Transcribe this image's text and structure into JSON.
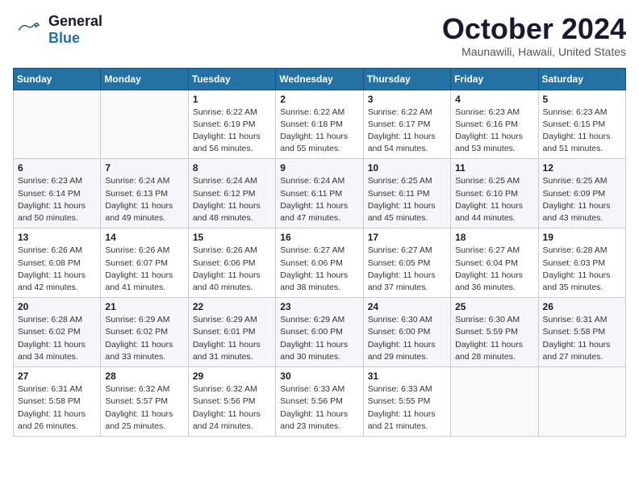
{
  "header": {
    "logo_line1": "General",
    "logo_line2": "Blue",
    "title": "October 2024",
    "subtitle": "Maunawili, Hawaii, United States"
  },
  "weekdays": [
    "Sunday",
    "Monday",
    "Tuesday",
    "Wednesday",
    "Thursday",
    "Friday",
    "Saturday"
  ],
  "weeks": [
    [
      {
        "day": "",
        "info": ""
      },
      {
        "day": "",
        "info": ""
      },
      {
        "day": "1",
        "info": "Sunrise: 6:22 AM\nSunset: 6:19 PM\nDaylight: 11 hours\nand 56 minutes."
      },
      {
        "day": "2",
        "info": "Sunrise: 6:22 AM\nSunset: 6:18 PM\nDaylight: 11 hours\nand 55 minutes."
      },
      {
        "day": "3",
        "info": "Sunrise: 6:22 AM\nSunset: 6:17 PM\nDaylight: 11 hours\nand 54 minutes."
      },
      {
        "day": "4",
        "info": "Sunrise: 6:23 AM\nSunset: 6:16 PM\nDaylight: 11 hours\nand 53 minutes."
      },
      {
        "day": "5",
        "info": "Sunrise: 6:23 AM\nSunset: 6:15 PM\nDaylight: 11 hours\nand 51 minutes."
      }
    ],
    [
      {
        "day": "6",
        "info": "Sunrise: 6:23 AM\nSunset: 6:14 PM\nDaylight: 11 hours\nand 50 minutes."
      },
      {
        "day": "7",
        "info": "Sunrise: 6:24 AM\nSunset: 6:13 PM\nDaylight: 11 hours\nand 49 minutes."
      },
      {
        "day": "8",
        "info": "Sunrise: 6:24 AM\nSunset: 6:12 PM\nDaylight: 11 hours\nand 48 minutes."
      },
      {
        "day": "9",
        "info": "Sunrise: 6:24 AM\nSunset: 6:11 PM\nDaylight: 11 hours\nand 47 minutes."
      },
      {
        "day": "10",
        "info": "Sunrise: 6:25 AM\nSunset: 6:11 PM\nDaylight: 11 hours\nand 45 minutes."
      },
      {
        "day": "11",
        "info": "Sunrise: 6:25 AM\nSunset: 6:10 PM\nDaylight: 11 hours\nand 44 minutes."
      },
      {
        "day": "12",
        "info": "Sunrise: 6:25 AM\nSunset: 6:09 PM\nDaylight: 11 hours\nand 43 minutes."
      }
    ],
    [
      {
        "day": "13",
        "info": "Sunrise: 6:26 AM\nSunset: 6:08 PM\nDaylight: 11 hours\nand 42 minutes."
      },
      {
        "day": "14",
        "info": "Sunrise: 6:26 AM\nSunset: 6:07 PM\nDaylight: 11 hours\nand 41 minutes."
      },
      {
        "day": "15",
        "info": "Sunrise: 6:26 AM\nSunset: 6:06 PM\nDaylight: 11 hours\nand 40 minutes."
      },
      {
        "day": "16",
        "info": "Sunrise: 6:27 AM\nSunset: 6:06 PM\nDaylight: 11 hours\nand 38 minutes."
      },
      {
        "day": "17",
        "info": "Sunrise: 6:27 AM\nSunset: 6:05 PM\nDaylight: 11 hours\nand 37 minutes."
      },
      {
        "day": "18",
        "info": "Sunrise: 6:27 AM\nSunset: 6:04 PM\nDaylight: 11 hours\nand 36 minutes."
      },
      {
        "day": "19",
        "info": "Sunrise: 6:28 AM\nSunset: 6:03 PM\nDaylight: 11 hours\nand 35 minutes."
      }
    ],
    [
      {
        "day": "20",
        "info": "Sunrise: 6:28 AM\nSunset: 6:02 PM\nDaylight: 11 hours\nand 34 minutes."
      },
      {
        "day": "21",
        "info": "Sunrise: 6:29 AM\nSunset: 6:02 PM\nDaylight: 11 hours\nand 33 minutes."
      },
      {
        "day": "22",
        "info": "Sunrise: 6:29 AM\nSunset: 6:01 PM\nDaylight: 11 hours\nand 31 minutes."
      },
      {
        "day": "23",
        "info": "Sunrise: 6:29 AM\nSunset: 6:00 PM\nDaylight: 11 hours\nand 30 minutes."
      },
      {
        "day": "24",
        "info": "Sunrise: 6:30 AM\nSunset: 6:00 PM\nDaylight: 11 hours\nand 29 minutes."
      },
      {
        "day": "25",
        "info": "Sunrise: 6:30 AM\nSunset: 5:59 PM\nDaylight: 11 hours\nand 28 minutes."
      },
      {
        "day": "26",
        "info": "Sunrise: 6:31 AM\nSunset: 5:58 PM\nDaylight: 11 hours\nand 27 minutes."
      }
    ],
    [
      {
        "day": "27",
        "info": "Sunrise: 6:31 AM\nSunset: 5:58 PM\nDaylight: 11 hours\nand 26 minutes."
      },
      {
        "day": "28",
        "info": "Sunrise: 6:32 AM\nSunset: 5:57 PM\nDaylight: 11 hours\nand 25 minutes."
      },
      {
        "day": "29",
        "info": "Sunrise: 6:32 AM\nSunset: 5:56 PM\nDaylight: 11 hours\nand 24 minutes."
      },
      {
        "day": "30",
        "info": "Sunrise: 6:33 AM\nSunset: 5:56 PM\nDaylight: 11 hours\nand 23 minutes."
      },
      {
        "day": "31",
        "info": "Sunrise: 6:33 AM\nSunset: 5:55 PM\nDaylight: 11 hours\nand 21 minutes."
      },
      {
        "day": "",
        "info": ""
      },
      {
        "day": "",
        "info": ""
      }
    ]
  ]
}
